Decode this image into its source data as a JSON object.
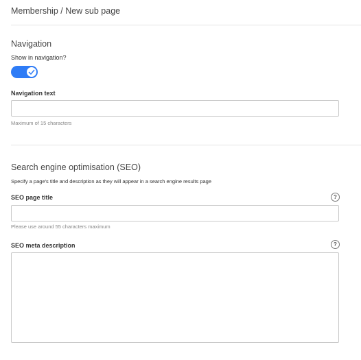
{
  "breadcrumb": {
    "text": "Membership / New sub page"
  },
  "navigation": {
    "title": "Navigation",
    "show_label": "Show in navigation?",
    "show_enabled": true,
    "text_label": "Navigation text",
    "text_value": "",
    "text_hint": "Maximum of 15 characters"
  },
  "seo": {
    "title": "Search engine optimisation (SEO)",
    "description": "Specify a page's title and description as they will appear in a search engine results page",
    "page_title_label": "SEO page title",
    "page_title_value": "",
    "page_title_hint": "Please use around 55 characters maximum",
    "meta_label": "SEO meta description",
    "meta_value": "",
    "help_glyph": "?"
  },
  "colors": {
    "accent": "#2e7cf6",
    "divider": "#e3e3e3",
    "border": "#c9c9c9"
  }
}
